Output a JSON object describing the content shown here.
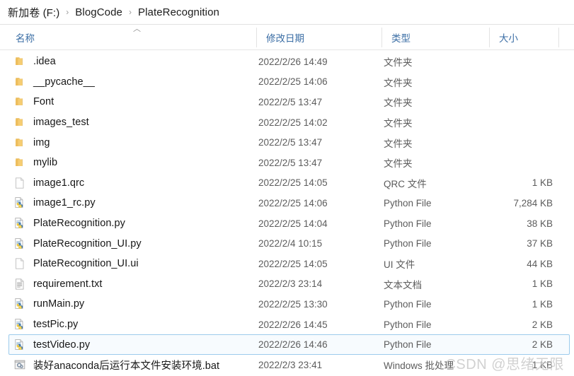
{
  "breadcrumb": {
    "separator": "›",
    "items": [
      {
        "label": "新加卷 (F:)"
      },
      {
        "label": "BlogCode"
      },
      {
        "label": "PlateRecognition"
      }
    ]
  },
  "columns": {
    "name": "名称",
    "date": "修改日期",
    "type": "类型",
    "size": "大小",
    "sort_caret": "︿",
    "sort_direction": "ascending",
    "sort_column": "名称"
  },
  "colors": {
    "header_text": "#3b6ea5",
    "row_text": "#171717",
    "meta_text": "#5c5c5c",
    "selection_border": "#9ccbec",
    "selection_fill": "#f7fbfe",
    "folder_icon": "#f2c367",
    "python_blue": "#3b72a3",
    "python_yellow": "#f2cb3e"
  },
  "files": [
    {
      "name": ".idea",
      "date": "2022/2/26 14:49",
      "type": "文件夹",
      "size": "",
      "icon": "folder-icon",
      "selected": false
    },
    {
      "name": "__pycache__",
      "date": "2022/2/25 14:06",
      "type": "文件夹",
      "size": "",
      "icon": "folder-icon",
      "selected": false
    },
    {
      "name": "Font",
      "date": "2022/2/5 13:47",
      "type": "文件夹",
      "size": "",
      "icon": "folder-icon",
      "selected": false
    },
    {
      "name": "images_test",
      "date": "2022/2/25 14:02",
      "type": "文件夹",
      "size": "",
      "icon": "folder-icon",
      "selected": false
    },
    {
      "name": "img",
      "date": "2022/2/5 13:47",
      "type": "文件夹",
      "size": "",
      "icon": "folder-icon",
      "selected": false
    },
    {
      "name": "mylib",
      "date": "2022/2/5 13:47",
      "type": "文件夹",
      "size": "",
      "icon": "folder-icon",
      "selected": false
    },
    {
      "name": "image1.qrc",
      "date": "2022/2/25 14:05",
      "type": "QRC 文件",
      "size": "1 KB",
      "icon": "blank-page-icon",
      "selected": false
    },
    {
      "name": "image1_rc.py",
      "date": "2022/2/25 14:06",
      "type": "Python File",
      "size": "7,284 KB",
      "icon": "python-file-icon",
      "selected": false
    },
    {
      "name": "PlateRecognition.py",
      "date": "2022/2/25 14:04",
      "type": "Python File",
      "size": "38 KB",
      "icon": "python-file-icon",
      "selected": false
    },
    {
      "name": "PlateRecognition_UI.py",
      "date": "2022/2/4 10:15",
      "type": "Python File",
      "size": "37 KB",
      "icon": "python-file-icon",
      "selected": false
    },
    {
      "name": "PlateRecognition_UI.ui",
      "date": "2022/2/25 14:05",
      "type": "UI 文件",
      "size": "44 KB",
      "icon": "blank-page-icon",
      "selected": false
    },
    {
      "name": "requirement.txt",
      "date": "2022/2/3 23:14",
      "type": "文本文档",
      "size": "1 KB",
      "icon": "text-file-icon",
      "selected": false
    },
    {
      "name": "runMain.py",
      "date": "2022/2/25 13:30",
      "type": "Python File",
      "size": "1 KB",
      "icon": "python-file-icon",
      "selected": false
    },
    {
      "name": "testPic.py",
      "date": "2022/2/26 14:45",
      "type": "Python File",
      "size": "2 KB",
      "icon": "python-file-icon",
      "selected": false
    },
    {
      "name": "testVideo.py",
      "date": "2022/2/26 14:46",
      "type": "Python File",
      "size": "2 KB",
      "icon": "python-file-icon",
      "selected": true
    },
    {
      "name": "装好anaconda后运行本文件安装环境.bat",
      "date": "2022/2/3 23:41",
      "type": "Windows 批处理",
      "size": "1 KB",
      "icon": "batch-file-icon",
      "selected": false
    }
  ],
  "watermark": "CSDN @思绪无限"
}
